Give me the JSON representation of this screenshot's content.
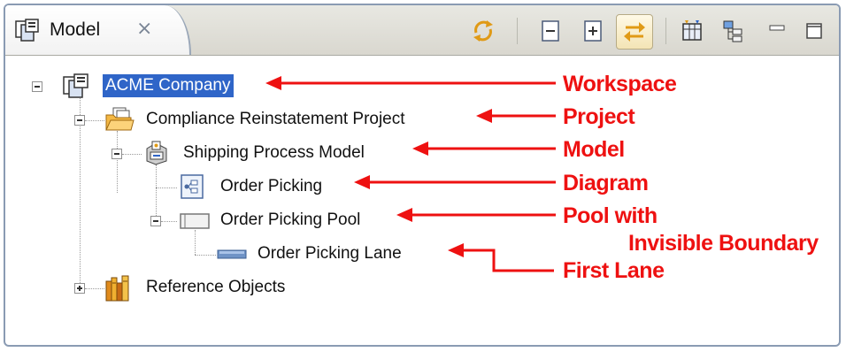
{
  "tab": {
    "label": "Model",
    "close_glyph": "⨯"
  },
  "toolbar": [
    {
      "icon": "sync-icon"
    },
    {
      "icon": "collapse-all-icon"
    },
    {
      "icon": "expand-all-icon"
    },
    {
      "icon": "link-with-editor-icon",
      "pressed": true
    },
    {
      "icon": "table-view-icon"
    },
    {
      "icon": "hierarchy-icon"
    },
    {
      "icon": "minimize-icon"
    },
    {
      "icon": "maximize-icon"
    }
  ],
  "tree": {
    "workspace": "ACME Company",
    "project": "Compliance Reinstatement Project",
    "model": "Shipping Process Model",
    "diagram": "Order Picking",
    "pool": "Order Picking Pool",
    "lane": "Order Picking Lane",
    "reference": "Reference Objects"
  },
  "annotations": {
    "workspace": "Workspace",
    "project": "Project",
    "model": "Model",
    "diagram": "Diagram",
    "pool_line1": "Pool with",
    "pool_line2": "Invisible Boundary",
    "lane": "First Lane"
  },
  "colors": {
    "selection": "#2f65c8",
    "annotation": "#ee1111"
  }
}
